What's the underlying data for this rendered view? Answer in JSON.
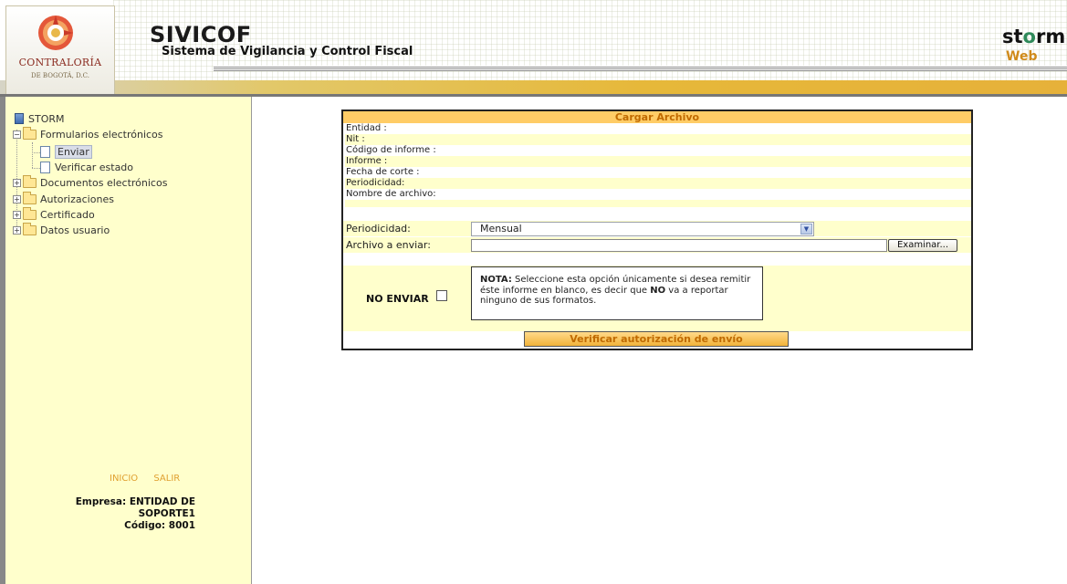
{
  "header": {
    "logo_name": "CONTRALORÍA",
    "logo_subtitle": "DE BOGOTÁ, D.C.",
    "app_title": "SIVICOF",
    "app_subtitle": "Sistema de Vigilancia y Control Fiscal",
    "brand_prefix": "st",
    "brand_o": "o",
    "brand_suffix": "rm",
    "brand_web": "Web"
  },
  "sidebar": {
    "root": "STORM",
    "items": [
      {
        "label": "Formularios electrónicos",
        "expanded": true
      },
      {
        "label": "Enviar",
        "selected": true
      },
      {
        "label": "Verificar estado"
      },
      {
        "label": "Documentos electrónicos",
        "expanded": false
      },
      {
        "label": "Autorizaciones",
        "expanded": false
      },
      {
        "label": "Certificado",
        "expanded": false
      },
      {
        "label": "Datos usuario",
        "expanded": false
      }
    ],
    "links": [
      "INICIO",
      "SALIR"
    ],
    "company_line1": "Empresa: ENTIDAD DE",
    "company_line2": "SOPORTE1",
    "company_line3": "Código: 8001"
  },
  "panel": {
    "title": "Cargar Archivo",
    "info_rows": [
      "Entidad :",
      "Nit :",
      "Código de informe :",
      "Informe :",
      "Fecha de corte :",
      "Periodicidad:",
      "Nombre de archivo:"
    ],
    "periodicidad_label": "Periodicidad:",
    "periodicidad_value": "Mensual",
    "archivo_label": "Archivo a enviar:",
    "archivo_value": "",
    "browse_label": "Examinar...",
    "no_enviar_label": "NO ENVIAR",
    "nota_bold": "NOTA:",
    "nota_text_1": " Seleccione esta opción únicamente si desea remitir éste informe en blanco, es decir que ",
    "nota_no": "NO",
    "nota_text_2": " va a reportar ninguno de sus formatos.",
    "verify_label": "Verificar autorización de envío"
  },
  "colors": {
    "sidebar_bg": "#ffffcc",
    "panel_title_bg": "#ffcc66",
    "accent_orange": "#c06a00",
    "link_color": "#e0a030"
  }
}
